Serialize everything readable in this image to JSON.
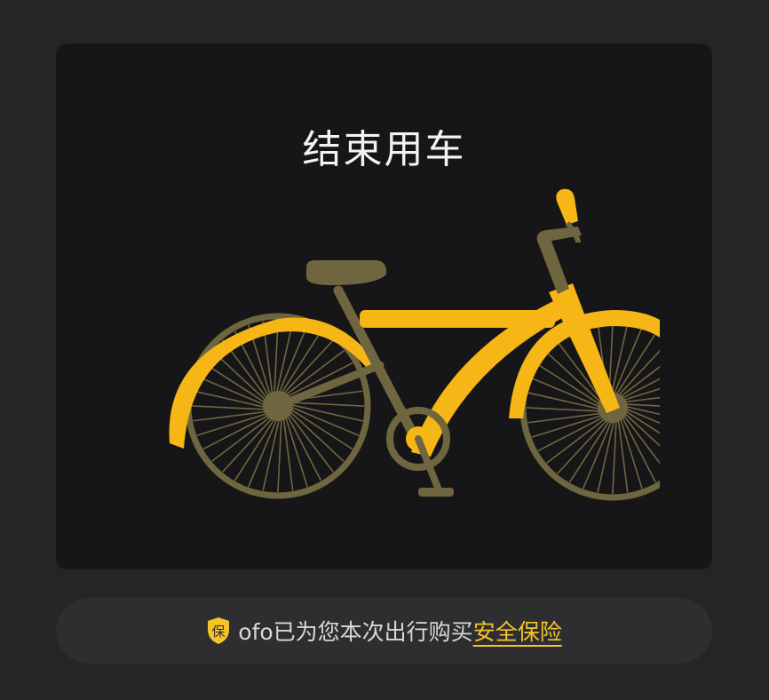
{
  "end_ride_card": {
    "title": "结束用车",
    "illustration_icon": "bicycle-icon"
  },
  "insurance_banner": {
    "badge_text": "保",
    "badge_icon": "shield-icon",
    "text": "ofo已为您本次出行购买",
    "link_label": "安全保险"
  },
  "colors": {
    "background": "#252526",
    "card": "#161618",
    "accent_yellow": "#f5c428",
    "bike_dark": "#6f6640"
  }
}
